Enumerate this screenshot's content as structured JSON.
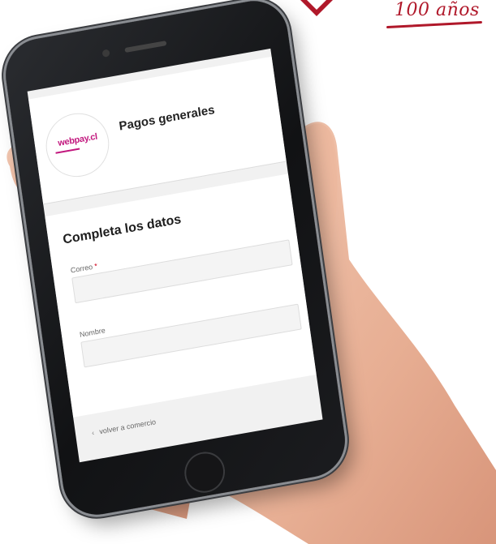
{
  "brand": {
    "years_text": "100 años",
    "accent_color": "#b0182a"
  },
  "screen": {
    "merchant": {
      "logo_text": "webpay.cl",
      "logo_color": "#c2187e",
      "name": "Pagos generales"
    },
    "form": {
      "title": "Completa los datos",
      "fields": [
        {
          "label": "Correo",
          "required_mark": "*",
          "value": ""
        },
        {
          "label": "Nombre",
          "value": ""
        }
      ]
    },
    "back_link": {
      "icon": "arrow-left-icon",
      "label": "volver a comercio"
    }
  }
}
